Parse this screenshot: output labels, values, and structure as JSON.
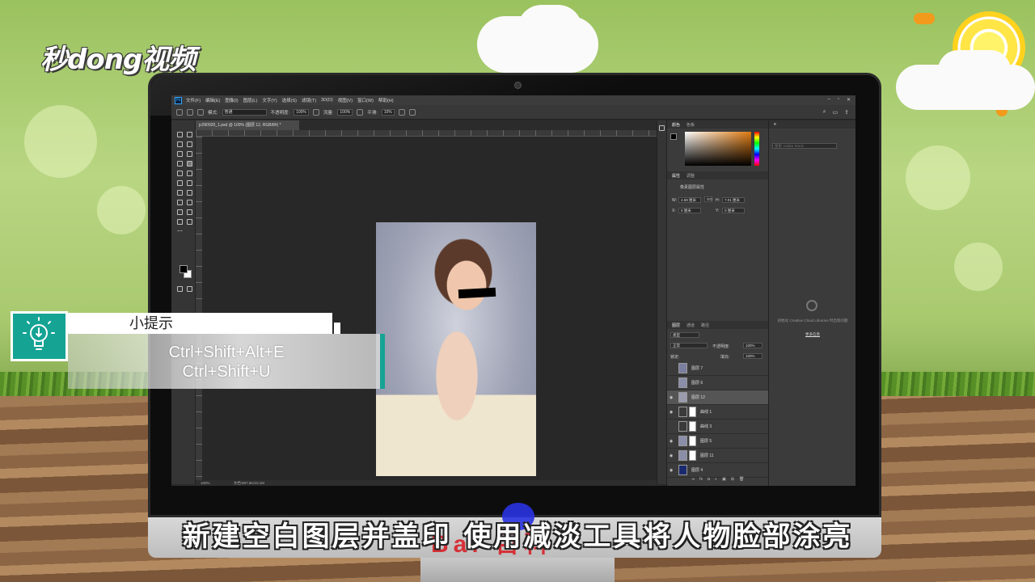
{
  "brand": {
    "logo_text": "秒dong视频"
  },
  "photoshop": {
    "menu": [
      "文件(F)",
      "编辑(E)",
      "图像(I)",
      "图层(L)",
      "文字(Y)",
      "选择(S)",
      "滤镜(T)",
      "3D(D)",
      "视图(V)",
      "窗口(W)",
      "帮助(H)"
    ],
    "options": {
      "mode_label": "模式:",
      "mode_value": "普通",
      "opacity_label": "不透明度:",
      "opacity_value": "100%",
      "flow_label": "流量:",
      "flow_value": "100%",
      "smooth_label": "平滑:",
      "smooth_value": "10%"
    },
    "document_tab": "jc090920_1.psd @ 100% (图层 12, RGB/8#) *",
    "status": {
      "zoom": "100%",
      "doc_size": "文档:887.5K/10.1M"
    },
    "color_panel": {
      "tabs": [
        "颜色",
        "色板"
      ],
      "foreground": "#000000"
    },
    "properties_panel": {
      "tabs": [
        "属性",
        "调整"
      ],
      "title": "像素图层属性",
      "w_label": "W:",
      "w_value": "4.69 厘米",
      "h_label": "H:",
      "h_value": "7.01 厘米",
      "x_label": "X:",
      "x_value": "0 厘米",
      "y_label": "Y:",
      "y_value": "0 厘米",
      "link_icon": "GO"
    },
    "libraries_panel": {
      "search_placeholder": "搜索 Adobe Stock",
      "message": "初始化 Creative Cloud Libraries 时出现问题",
      "link": "更多信息"
    },
    "layers_panel": {
      "tabs": [
        "图层",
        "通道",
        "路径"
      ],
      "filter": "类型",
      "blend_mode": "正常",
      "opacity_label": "不透明度:",
      "opacity_value": "100%",
      "lock_label": "锁定:",
      "fill_label": "填充:",
      "fill_value": "100%",
      "layers": [
        {
          "name": "图层 7",
          "visible": false,
          "thumb": "#7a7fa0",
          "mask": false
        },
        {
          "name": "图层 6",
          "visible": false,
          "thumb": "#8a8ea8",
          "mask": false
        },
        {
          "name": "图层 12",
          "visible": true,
          "thumb": "#9a9cae",
          "mask": false,
          "selected": true
        },
        {
          "name": "曲线 1",
          "visible": true,
          "thumb": "#3a3a3a",
          "mask": true
        },
        {
          "name": "曲线 3",
          "visible": false,
          "thumb": "#3a3a3a",
          "mask": true
        },
        {
          "name": "图层 5",
          "visible": true,
          "thumb": "#8a8ea8",
          "mask": true
        },
        {
          "name": "图层 11",
          "visible": true,
          "thumb": "#8a8ea8",
          "mask": true
        },
        {
          "name": "图层 4",
          "visible": true,
          "thumb": "#1a2a6e",
          "mask": false
        }
      ]
    }
  },
  "tip": {
    "title": "小提示",
    "line1": "Ctrl+Shift+Alt+E",
    "line2": "Ctrl+Shift+U"
  },
  "subtitle": "新建空白图层并盖印 使用减淡工具将人物脸部涂亮",
  "watermark": "Bai 百科"
}
